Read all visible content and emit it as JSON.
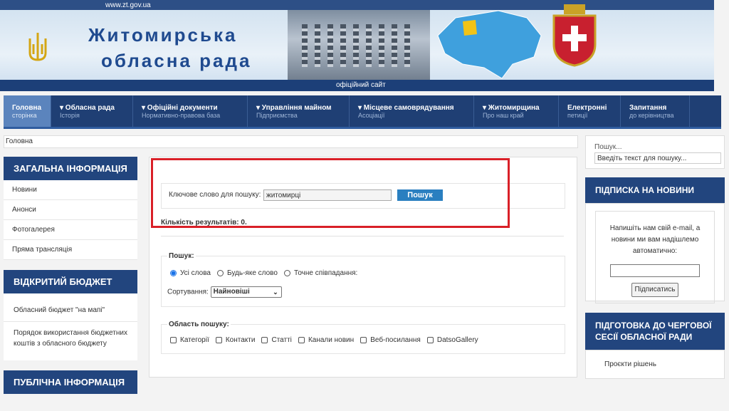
{
  "header": {
    "url": "www.zt.gov.ua",
    "title_line1": "Житомирська",
    "title_line2": "обласна рада",
    "subtitle": "офіційний сайт"
  },
  "nav": [
    {
      "label": "Головна",
      "sub": "сторінка",
      "active": true
    },
    {
      "label": "▾ Обласна рада",
      "sub": "Історія"
    },
    {
      "label": "▾ Офіційні документи",
      "sub": "Нормативно-правова база"
    },
    {
      "label": "▾ Управління майном",
      "sub": "Підприємства"
    },
    {
      "label": "▾ Місцеве самоврядування",
      "sub": "Асоціації"
    },
    {
      "label": "▾ Житомирщина",
      "sub": "Про наш край"
    },
    {
      "label": "Електронні",
      "sub": "петиції"
    },
    {
      "label": "Запитання",
      "sub": "до керівництва"
    }
  ],
  "breadcrumb": "Головна",
  "left": {
    "general_title": "ЗАГАЛЬНА ІНФОРМАЦІЯ",
    "general_items": [
      "Новини",
      "Анонси",
      "Фотогалерея",
      "Пряма трансляція"
    ],
    "budget_title": "ВІДКРИТИЙ БЮДЖЕТ",
    "budget_items": [
      "Обласний бюджет \"на мапі\"",
      "Порядок використання бюджетних коштів з обласного бюджету"
    ],
    "public_title": "ПУБЛІЧНА ІНФОРМАЦІЯ"
  },
  "search": {
    "label": "Ключове слово для пошуку:",
    "value": "житомирці",
    "button": "Пошук",
    "result_count": "Кількість результатів: 0.",
    "options_legend": "Пошук:",
    "mode_options": [
      "Усі слова",
      "Будь-яке слово",
      "Точне співпадання:"
    ],
    "mode_selected": 0,
    "sort_label": "Сортування:",
    "sort_value": "Найновіші",
    "area_legend": "Область пошуку:",
    "area_options": [
      "Категорії",
      "Контакти",
      "Статті",
      "Канали новин",
      "Веб-посилання",
      "DatsoGallery"
    ]
  },
  "right": {
    "search_label": "Пошук...",
    "search_placeholder": "Введіть текст для пошуку...",
    "subscribe_title": "ПІДПИСКА НА НОВИНИ",
    "subscribe_text": "Напишіть нам свій e-mail, а новини ми вам надішлемо автоматично:",
    "subscribe_button": "Підписатись",
    "session_title": "ПІДГОТОВКА ДО ЧЕРГОВОЇ СЕСІЇ ОБЛАСНОЇ РАДИ",
    "session_item": "Проєкти рішень"
  },
  "colors": {
    "nav_bg": "#1f3f74",
    "nav_active": "#5b84bd",
    "section_head": "#22457e",
    "search_button": "#2a7fc0",
    "highlight_box": "#d92028"
  }
}
